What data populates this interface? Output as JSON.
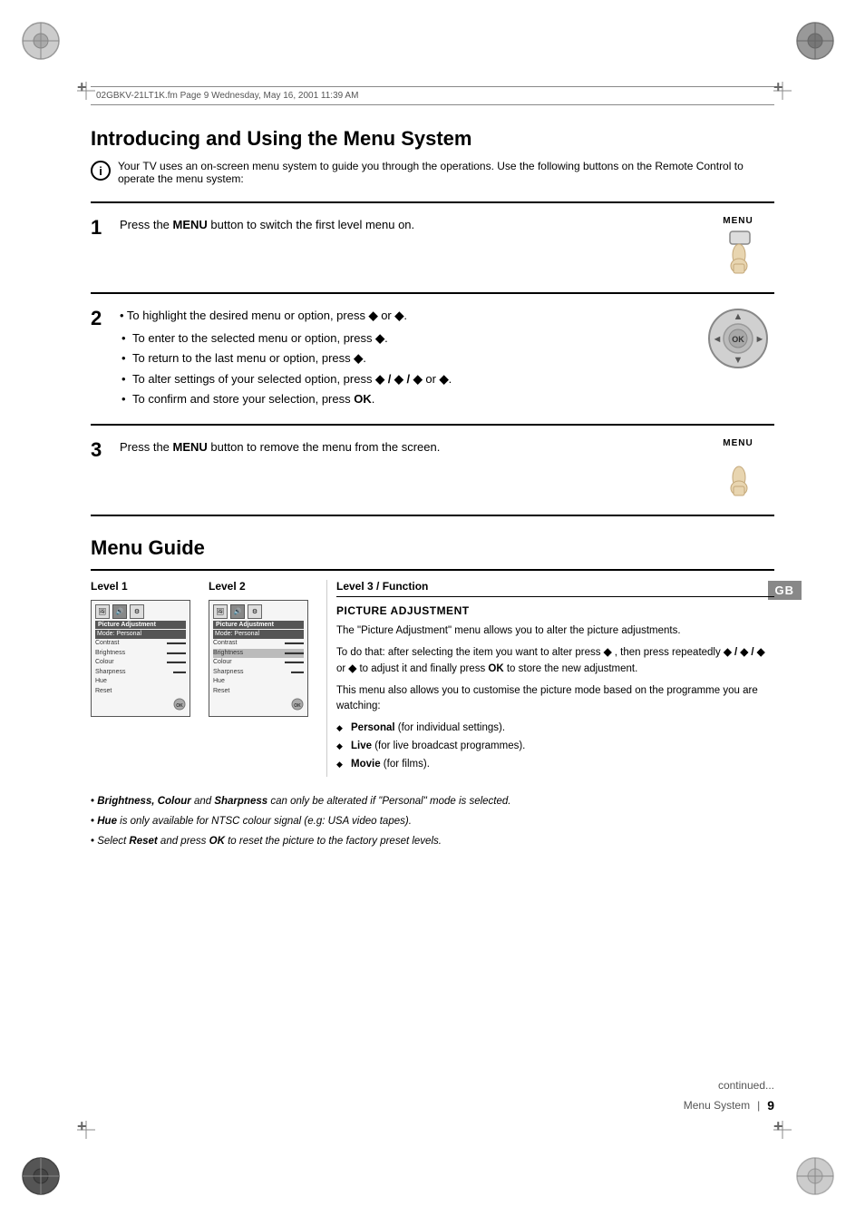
{
  "page": {
    "file_info": "02GBKV-21LT1K.fm  Page 9  Wednesday, May 16, 2001  11:39 AM",
    "gb_badge": "GB",
    "section_title": "Introducing and Using the Menu System",
    "info_text": "Your TV uses an on-screen menu system to guide you through the operations. Use the following buttons on the Remote Control to operate the menu system:",
    "steps": [
      {
        "number": "1",
        "text": "Press the ",
        "bold": "MENU",
        "text2": " button to switch the first level menu on.",
        "image_type": "menu_button",
        "image_label": "MENU"
      },
      {
        "number": "2",
        "image_type": "ok_button",
        "bullets": [
          "To highlight the desired menu or option, press ◆ or ◆.",
          "To enter to the selected menu or option, press ◆.",
          "To return to the last menu or option, press ◆.",
          "To alter settings of your selected option, press ◆ / ◆ / ◆ or ◆.",
          "To confirm and store your selection, press OK."
        ]
      },
      {
        "number": "3",
        "text": "Press the ",
        "bold": "MENU",
        "text2": " button to remove the menu from the screen.",
        "image_type": "menu_button",
        "image_label": "MENU"
      }
    ],
    "menu_guide": {
      "title": "Menu Guide",
      "col1_header": "Level 1",
      "col2_header": "Level 2",
      "col3_header": "Level 3 / Function",
      "level3_title": "PICTURE ADJUSTMENT",
      "level3_intro": "The \"Picture Adjustment\" menu allows you to alter the picture adjustments.",
      "level3_detail": "To do that: after selecting the item you want to alter press ◆ , then press repeatedly ◆ / ◆ / ◆ or ◆ to adjust it and finally press OK to store the new adjustment.",
      "level3_detail2": "This menu also allows you to customise the picture mode based on the programme you are watching:",
      "level3_bullets": [
        "Personal (for individual settings).",
        "Live (for live broadcast programmes).",
        "Movie (for films)."
      ],
      "level3_bullet_bold": [
        "Personal",
        "Live",
        "Movie"
      ],
      "screen1_items": [
        "Mode: Personal",
        "Contrast",
        "Brightness",
        "Colour",
        "Sharpness",
        "Hue",
        "Reset"
      ],
      "screen2_items": [
        "Mode: Personal",
        "Contrast",
        "Brightness",
        "Colour",
        "Sharpness",
        "Hue",
        "Reset"
      ]
    },
    "notes": [
      "Brightness, Colour and Sharpness can only be alterated if \"Personal\" mode is selected.",
      "Hue is only available for NTSC colour signal (e.g: USA video tapes).",
      "Select Reset and press OK to reset the picture to the factory preset levels."
    ],
    "footer": {
      "continued": "continued...",
      "section_label": "Menu System",
      "divider": "|",
      "page_num": "9"
    }
  }
}
